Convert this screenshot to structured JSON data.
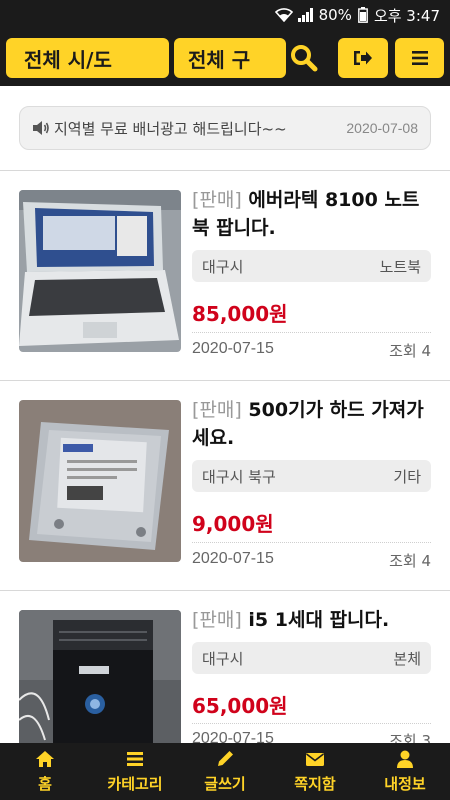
{
  "status_bar": {
    "battery": "80%",
    "time": "오후 3:47"
  },
  "top_bar": {
    "region_select": "전체 시/도",
    "district_select": "전체 구"
  },
  "notice": {
    "text": "지역별 무료 배너광고 해드립니다~~",
    "date": "2020-07-08"
  },
  "listings": [
    {
      "tag": "[판매]",
      "title": "에버라텍 8100 노트북 팝니다.",
      "location": "대구시",
      "category": "노트북",
      "price": "85,000원",
      "date": "2020-07-15",
      "views": "조회 4"
    },
    {
      "tag": "[판매]",
      "title": "500기가 하드 가져가세요.",
      "location": "대구시 북구",
      "category": "기타",
      "price": "9,000원",
      "date": "2020-07-15",
      "views": "조회 4"
    },
    {
      "tag": "[판매]",
      "title": "i5 1세대 팝니다.",
      "location": "대구시",
      "category": "본체",
      "price": "65,000원",
      "date": "2020-07-15",
      "views": "조회 3"
    }
  ],
  "bottom_nav": [
    {
      "label": "홈",
      "icon": "home-icon"
    },
    {
      "label": "카테고리",
      "icon": "list-icon"
    },
    {
      "label": "글쓰기",
      "icon": "pencil-icon"
    },
    {
      "label": "쪽지함",
      "icon": "envelope-icon"
    },
    {
      "label": "내정보",
      "icon": "user-icon"
    }
  ],
  "colors": {
    "accent": "#ffd327",
    "dark": "#1b1b1b",
    "price": "#d0021b"
  }
}
